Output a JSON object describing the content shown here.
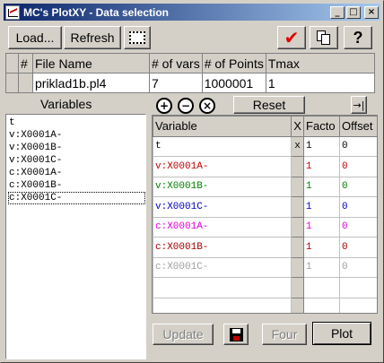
{
  "window": {
    "title": "MC's PlotXY - Data selection",
    "controls": {
      "minimize": "_",
      "maximize": "□",
      "close": "×"
    }
  },
  "toolbar": {
    "load_label": "Load...",
    "refresh_label": "Refresh",
    "check_icon": "✔",
    "help_label": "?"
  },
  "files_table": {
    "headers": [
      "#",
      "File Name",
      "# of vars",
      "# of Points",
      "Tmax"
    ],
    "rows": [
      {
        "num": "",
        "file_name": "priklad1b.pl4",
        "vars": "7",
        "points": "1000001",
        "tmax": "1"
      }
    ]
  },
  "variables": {
    "heading": "Variables",
    "items": [
      "t",
      "v:X0001A-",
      "v:X0001B-",
      "v:X0001C-",
      "c:X0001A-",
      "c:X0001B-",
      "c:X0001C-"
    ],
    "selected_index": 6
  },
  "selection": {
    "add_icon": "+",
    "remove_icon": "−",
    "clear_icon": "×",
    "reset_label": "Reset",
    "headers": {
      "variable": "Variable",
      "x": "X",
      "factor": "Facto",
      "offset": "Offset"
    },
    "rows": [
      {
        "variable": "t",
        "x": "x",
        "factor": "1",
        "offset": "0",
        "color": "#000000"
      },
      {
        "variable": "v:X0001A-",
        "x": "",
        "factor": "1",
        "offset": "0",
        "color": "#c00000"
      },
      {
        "variable": "v:X0001B-",
        "x": "",
        "factor": "1",
        "offset": "0",
        "color": "#008000"
      },
      {
        "variable": "v:X0001C-",
        "x": "",
        "factor": "1",
        "offset": "0",
        "color": "#0000c0"
      },
      {
        "variable": "c:X0001A-",
        "x": "",
        "factor": "1",
        "offset": "0",
        "color": "#e000e0"
      },
      {
        "variable": "c:X0001B-",
        "x": "",
        "factor": "1",
        "offset": "0",
        "color": "#a00000"
      },
      {
        "variable": "c:X0001C-",
        "x": "",
        "factor": "1",
        "offset": "0",
        "color": "#a0a0a0"
      }
    ]
  },
  "bottom_buttons": {
    "update_label": "Update",
    "four_label": "Four",
    "plot_label": "Plot"
  }
}
